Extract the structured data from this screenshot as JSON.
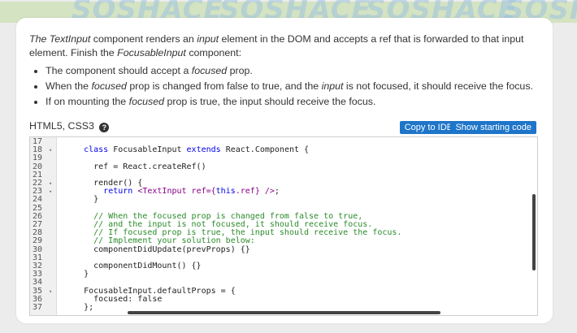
{
  "background": {
    "watermark_text": "SOSHACE"
  },
  "task": {
    "intro": [
      {
        "text": "The ",
        "em": true
      },
      {
        "text": "TextInput",
        "em": true
      },
      {
        "text": " component renders an ",
        "em": false
      },
      {
        "text": "input",
        "em": true
      },
      {
        "text": " element in the DOM and accepts a ref that is forwarded to that input element. Finish the ",
        "em": false
      },
      {
        "text": "FocusableInput",
        "em": true
      },
      {
        "text": " component:",
        "em": false
      }
    ],
    "bullets": [
      [
        {
          "text": "The component should accept a ",
          "em": false
        },
        {
          "text": "focused",
          "em": true
        },
        {
          "text": " prop.",
          "em": false
        }
      ],
      [
        {
          "text": "When the ",
          "em": false
        },
        {
          "text": "focused",
          "em": true
        },
        {
          "text": " prop is changed from false to true, and the ",
          "em": false
        },
        {
          "text": "input",
          "em": true
        },
        {
          "text": " is not focused, it should receive the focus.",
          "em": false
        }
      ],
      [
        {
          "text": "If on mounting the ",
          "em": false
        },
        {
          "text": "focused",
          "em": true
        },
        {
          "text": " prop is true, the input should receive the focus.",
          "em": false
        }
      ]
    ]
  },
  "toolbar": {
    "language_label": "HTML5, CSS3",
    "help_icon": "question-circle-icon",
    "copy_button": "Copy to IDE",
    "starting_code_button": "Show starting code"
  },
  "editor": {
    "lines": [
      {
        "n": "17",
        "fold": false,
        "tokens": []
      },
      {
        "n": "18",
        "fold": true,
        "tokens": [
          {
            "t": "    ",
            "c": ""
          },
          {
            "t": "class",
            "c": "kw"
          },
          {
            "t": " FocusableInput ",
            "c": ""
          },
          {
            "t": "extends",
            "c": "kw"
          },
          {
            "t": " React.Component {",
            "c": ""
          }
        ]
      },
      {
        "n": "19",
        "fold": false,
        "tokens": []
      },
      {
        "n": "20",
        "fold": false,
        "tokens": [
          {
            "t": "      ref = React.createRef()",
            "c": ""
          }
        ]
      },
      {
        "n": "21",
        "fold": false,
        "tokens": []
      },
      {
        "n": "22",
        "fold": true,
        "tokens": [
          {
            "t": "      render() {",
            "c": ""
          }
        ]
      },
      {
        "n": "23",
        "fold": true,
        "tokens": [
          {
            "t": "        ",
            "c": ""
          },
          {
            "t": "return",
            "c": "kw"
          },
          {
            "t": " ",
            "c": ""
          },
          {
            "t": "<TextInput ref={",
            "c": "str"
          },
          {
            "t": "this",
            "c": "kw"
          },
          {
            "t": ".ref} />",
            "c": "str"
          },
          {
            "t": ";",
            "c": ""
          }
        ]
      },
      {
        "n": "24",
        "fold": false,
        "tokens": [
          {
            "t": "      }",
            "c": ""
          }
        ]
      },
      {
        "n": "25",
        "fold": false,
        "tokens": []
      },
      {
        "n": "26",
        "fold": false,
        "tokens": [
          {
            "t": "      // When the focused prop is changed from false to true,",
            "c": "cm"
          }
        ]
      },
      {
        "n": "27",
        "fold": false,
        "tokens": [
          {
            "t": "      // and the input is not focused, it should receive focus.",
            "c": "cm"
          }
        ]
      },
      {
        "n": "28",
        "fold": false,
        "tokens": [
          {
            "t": "      // If focused prop is true, the input should receive the focus.",
            "c": "cm"
          }
        ]
      },
      {
        "n": "29",
        "fold": false,
        "tokens": [
          {
            "t": "      // Implement your solution below:",
            "c": "cm"
          }
        ]
      },
      {
        "n": "30",
        "fold": false,
        "tokens": [
          {
            "t": "      componentDidUpdate(prevProps) {}",
            "c": ""
          }
        ]
      },
      {
        "n": "31",
        "fold": false,
        "tokens": []
      },
      {
        "n": "32",
        "fold": false,
        "tokens": [
          {
            "t": "      componentDidMount() {}",
            "c": ""
          }
        ]
      },
      {
        "n": "33",
        "fold": false,
        "tokens": [
          {
            "t": "    }",
            "c": ""
          }
        ]
      },
      {
        "n": "34",
        "fold": false,
        "tokens": []
      },
      {
        "n": "35",
        "fold": true,
        "tokens": [
          {
            "t": "    FocusableInput.defaultProps = {",
            "c": ""
          }
        ]
      },
      {
        "n": "36",
        "fold": false,
        "tokens": [
          {
            "t": "      focused: false",
            "c": ""
          }
        ]
      },
      {
        "n": "37",
        "fold": false,
        "tokens": [
          {
            "t": "    };",
            "c": ""
          }
        ]
      }
    ]
  }
}
